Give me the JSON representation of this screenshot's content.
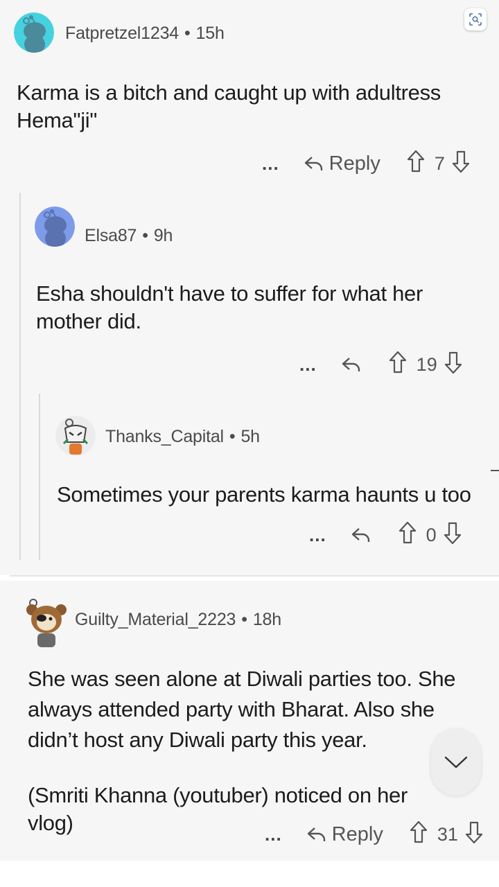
{
  "comments": [
    {
      "username": "Fatpretzel1234",
      "separator": "•",
      "age": "15h",
      "body": "Karma is a bitch and caught up with adultress Hema\"ji\"",
      "more": "...",
      "reply_label": "Reply",
      "score": "7",
      "avatar": "snoo-avatar-teal"
    },
    {
      "username": "Elsa87",
      "separator": "•",
      "age": "9h",
      "body": "Esha shouldn't have to suffer for what her mother did.",
      "more": "...",
      "reply_label": "",
      "score": "19",
      "avatar": "snoo-avatar-blue"
    },
    {
      "username": "Thanks_Capital",
      "separator": "•",
      "age": "5h",
      "body": "Sometimes your parents karma haunts u too",
      "more": "...",
      "reply_label": "",
      "score": "0",
      "avatar": "snoo-avatar-masked"
    },
    {
      "username": "Guilty_Material_2223",
      "separator": "•",
      "age": "18h",
      "body": "She was seen alone at Diwali parties too. She always attended party with Bharat. Also she didn’t host any Diwali party this year.",
      "body2": "(Smriti Khanna (youtuber) noticed on her vlog)",
      "more": "...",
      "reply_label": "Reply",
      "score": "31",
      "avatar": "snoo-avatar-bear"
    }
  ],
  "icons": {
    "reply": "reply-arrow-icon",
    "upvote": "upvote-arrow-icon",
    "downvote": "downvote-arrow-icon",
    "scroll": "chevron-down-icon",
    "scan": "image-search-icon"
  },
  "colors": {
    "comment_bg": "#f6f6f6",
    "thread_line": "#d9d9d9",
    "text": "#1c1c1c",
    "meta": "#4a4a4a",
    "avatar_teal": "#46d1df",
    "avatar_blue": "#7e9bea"
  }
}
